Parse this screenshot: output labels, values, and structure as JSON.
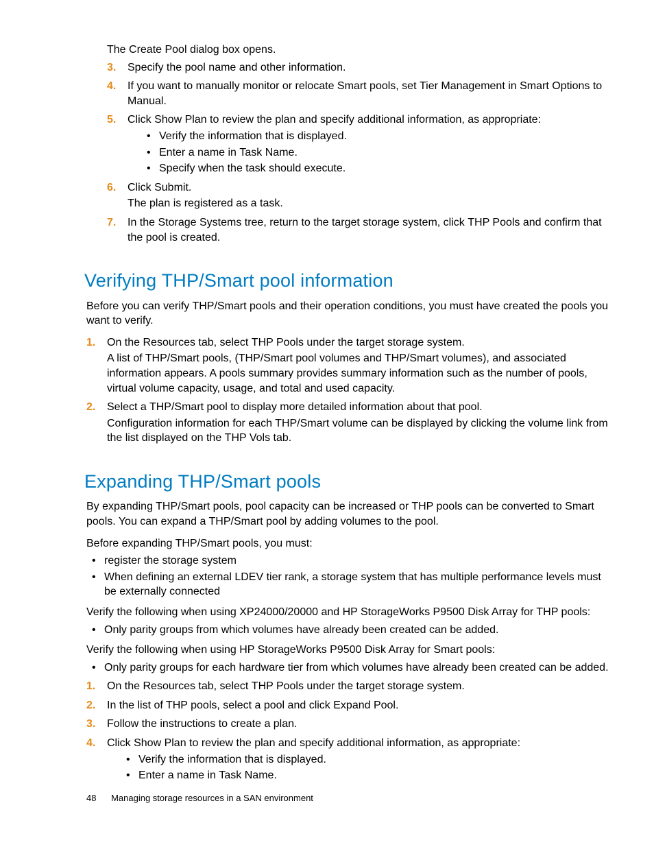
{
  "top": {
    "intro": "The <b>Create Pool</b> dialog box opens.",
    "items": [
      {
        "n": "3.",
        "t": "Specify the pool name and other information."
      },
      {
        "n": "4.",
        "t": "If you want to manually monitor or relocate Smart pools, set <b>Tier Management</b> in <b>Smart Options</b> to <b>Manual</b>."
      },
      {
        "n": "5.",
        "t": "Click <b>Show Plan</b> to review the plan and specify additional information, as appropriate:",
        "sub": [
          "Verify the information that is displayed.",
          "Enter a name in <b>Task Name</b>.",
          "Specify when the task should execute."
        ]
      },
      {
        "n": "6.",
        "t": "Click <b>Submit</b>.",
        "after": "The plan is registered as a task."
      },
      {
        "n": "7.",
        "t": "In the <b>Storage Systems</b> tree, return to the target storage system, click <b>THP Pools</b> and confirm that the pool is created."
      }
    ]
  },
  "sec1": {
    "title": "Verifying THP/Smart pool information",
    "intro": "Before you can verify THP/Smart pools and their operation conditions, you must have created the pools you want to verify.",
    "items": [
      {
        "n": "1.",
        "t": "On the <b>Resources</b> tab, select <b>THP Pools</b> under the target storage system.",
        "after": "A list of THP/Smart pools, (THP/Smart pool volumes and THP/Smart volumes), and associated information appears. A pools summary provides summary information such as the number of pools, virtual volume capacity, usage, and total and used capacity."
      },
      {
        "n": "2.",
        "t": "Select a THP/Smart pool to display more detailed information about that pool.",
        "after": "Configuration information for each THP/Smart volume can be displayed by clicking the volume link from the list displayed on the <b>THP Vols</b> tab."
      }
    ]
  },
  "sec2": {
    "title": "Expanding THP/Smart pools",
    "p1": "By expanding THP/Smart pools, pool capacity can be increased or THP pools can be converted to Smart pools. You can expand a THP/Smart pool by adding volumes to the pool.",
    "p2": "Before expanding THP/Smart pools, you must:",
    "b1": [
      "register the storage system",
      "When defining an external LDEV tier rank, a storage system that has multiple performance levels must be externally connected"
    ],
    "p3": "Verify the following when using XP24000/20000 and HP StorageWorks P9500 Disk Array for THP pools:",
    "b2": [
      "Only parity groups from which volumes have already been created can be added."
    ],
    "p4": "Verify the following when using HP StorageWorks P9500 Disk Array for Smart pools:",
    "b3": [
      "Only parity groups for each hardware tier from which volumes have already been created can be added."
    ],
    "items": [
      {
        "n": "1.",
        "t": "On the <b>Resources</b> tab, select <b>THP Pools</b> under the target storage system."
      },
      {
        "n": "2.",
        "t": "In the list of THP pools, select a pool and click <b>Expand Pool</b>."
      },
      {
        "n": "3.",
        "t": "Follow the instructions to create a plan."
      },
      {
        "n": "4.",
        "t": "Click <b>Show Plan</b> to review the plan and specify additional information, as appropriate:",
        "sub": [
          "Verify the information that is displayed.",
          "Enter a name in <b>Task Name</b>."
        ]
      }
    ]
  },
  "footer": {
    "page": "48",
    "chapter": "Managing storage resources in a SAN environment"
  }
}
